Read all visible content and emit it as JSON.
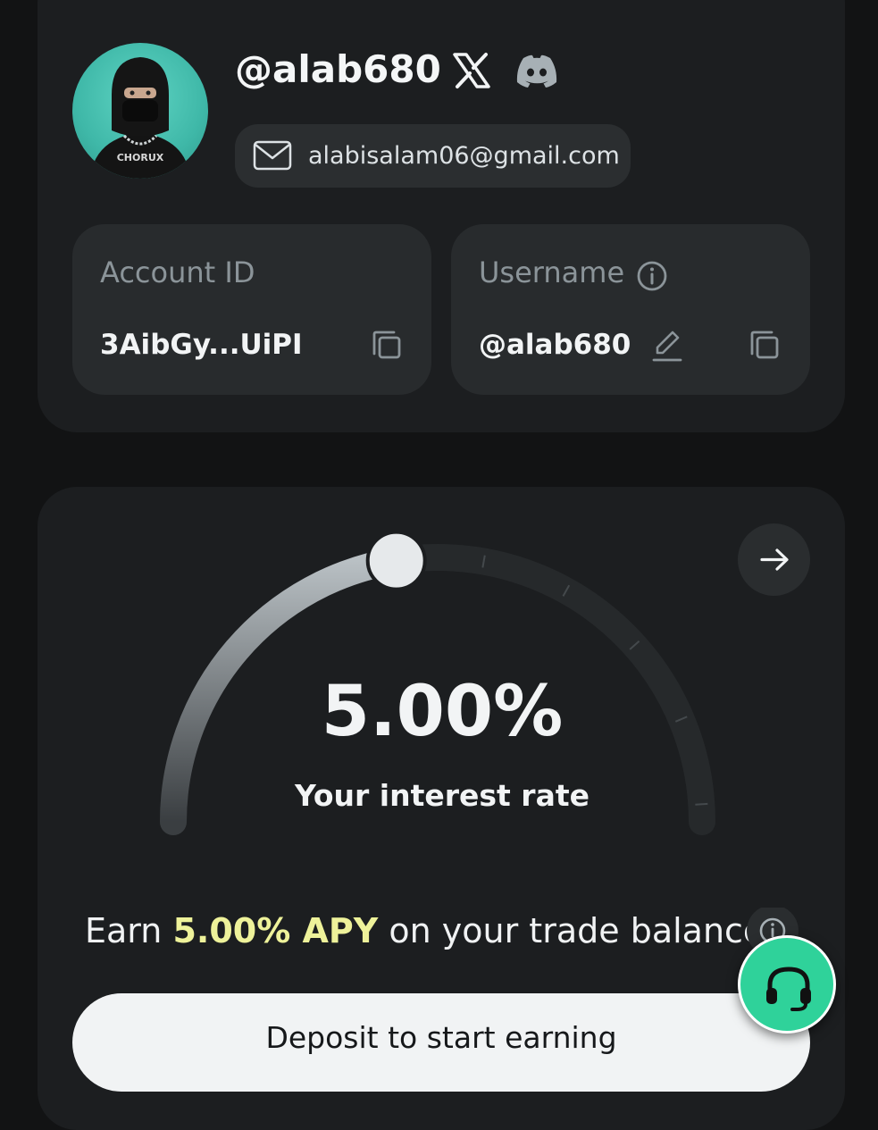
{
  "profile": {
    "handle": "@alab680",
    "email": "alabisalam06@gmail.com",
    "social_icons": [
      "x-icon",
      "discord-icon"
    ],
    "avatar_text": "CHORUX"
  },
  "account_box": {
    "label": "Account ID",
    "value": "3AibGy...UiPI"
  },
  "username_box": {
    "label": "Username",
    "value": "@alab680"
  },
  "interest": {
    "rate": "5.00%",
    "label": "Your interest rate",
    "gauge_fraction": 0.45
  },
  "earn": {
    "prefix": "Earn",
    "apy": "5.00% APY",
    "suffix": "on your trade balance"
  },
  "deposit_button": {
    "label": "Deposit to start earning"
  },
  "colors": {
    "background": "#121314",
    "card": "#1c1e20",
    "accent_yellow": "#eef29a",
    "support_green": "#2fd29a"
  }
}
